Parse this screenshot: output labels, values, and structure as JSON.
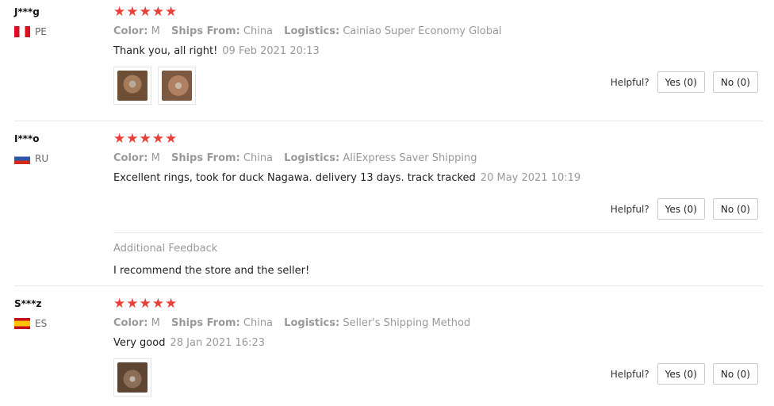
{
  "labels": {
    "color": "Color:",
    "ships_from": "Ships From:",
    "logistics": "Logistics:",
    "helpful": "Helpful?",
    "yes": "Yes (0)",
    "no": "No (0)",
    "additional_feedback": "Additional Feedback"
  },
  "colors": {
    "star": "#e8413a",
    "meta": "#999999",
    "border": "#e8e8e8"
  },
  "reviews": [
    {
      "user": "J***g",
      "country": "PE",
      "stars": 5,
      "color": "M",
      "ships_from": "China",
      "logistics": "Cainiao Super Economy Global",
      "text": "Thank you, all right!",
      "date": "09 Feb 2021 20:13"
    },
    {
      "user": "I***o",
      "country": "RU",
      "stars": 5,
      "color": "M",
      "ships_from": "China",
      "logistics": "AliExpress Saver Shipping",
      "text": "Excellent rings, took for duck Nagawa. delivery 13 days. track tracked",
      "date": "20 May 2021 10:19",
      "additional_feedback": "I recommend the store and the seller!"
    },
    {
      "user": "S***z",
      "country": "ES",
      "stars": 5,
      "color": "M",
      "ships_from": "China",
      "logistics": "Seller's Shipping Method",
      "text": "Very good",
      "date": "28 Jan 2021 16:23"
    }
  ]
}
